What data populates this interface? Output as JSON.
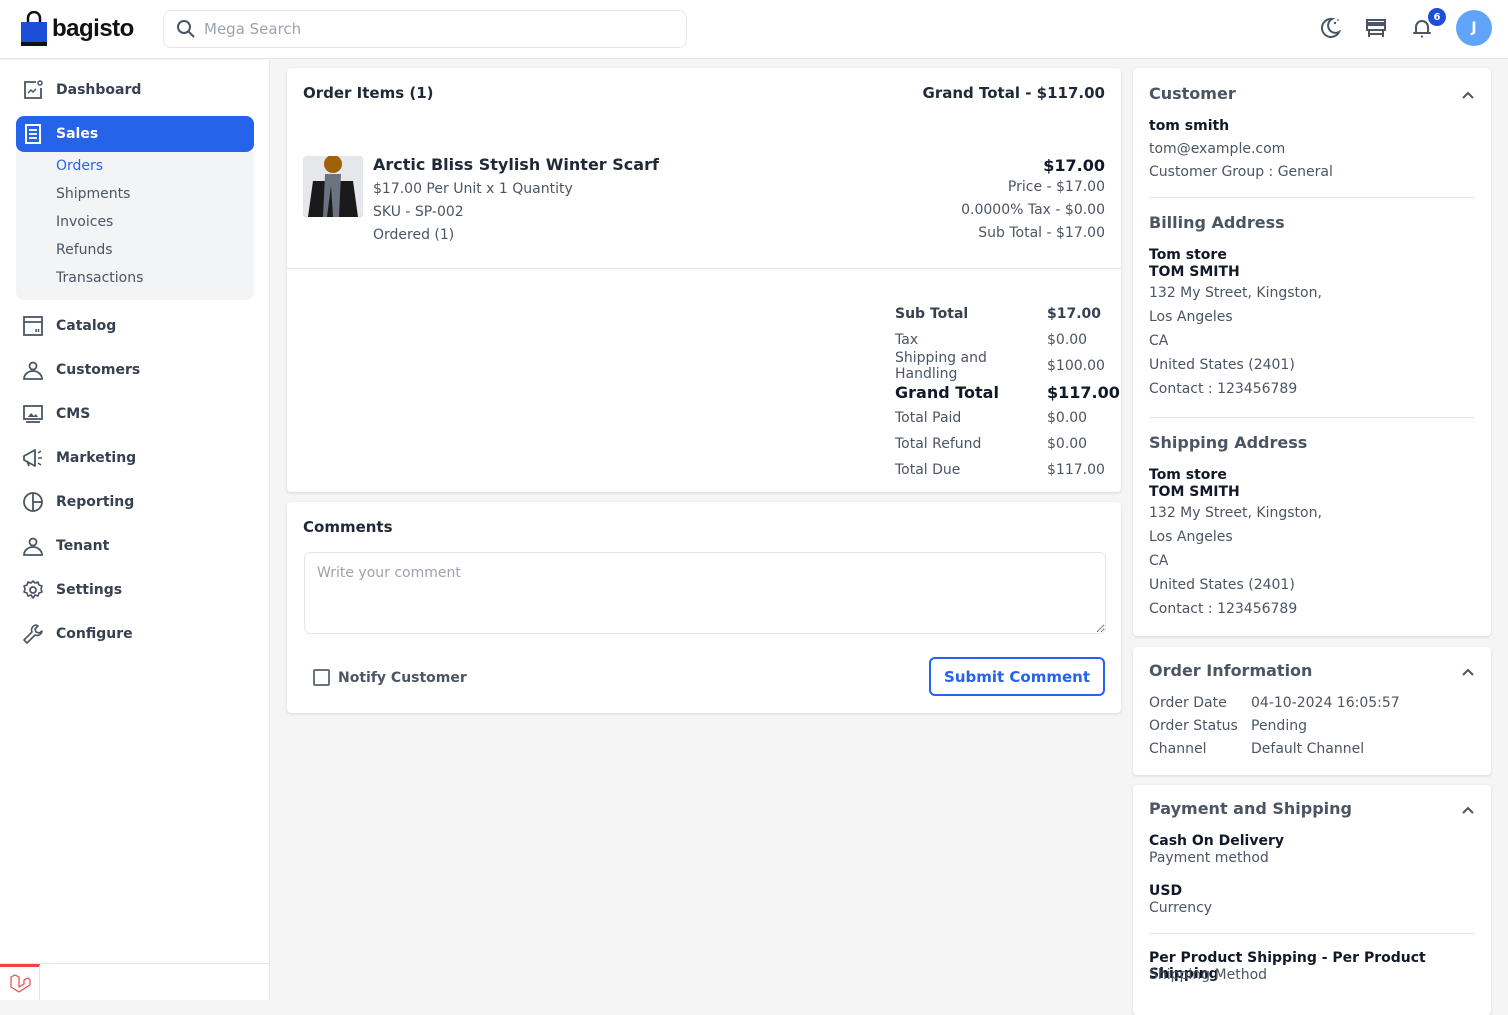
{
  "app": {
    "brand": "bagisto"
  },
  "header": {
    "search_placeholder": "Mega Search",
    "notification_count": "6",
    "avatar_initial": "J"
  },
  "sidebar": {
    "items": [
      {
        "label": "Dashboard",
        "icon": "dashboard-icon"
      },
      {
        "label": "Sales",
        "icon": "sales-icon",
        "active": true
      },
      {
        "label": "Catalog",
        "icon": "catalog-icon"
      },
      {
        "label": "Customers",
        "icon": "customers-icon"
      },
      {
        "label": "CMS",
        "icon": "cms-icon"
      },
      {
        "label": "Marketing",
        "icon": "marketing-icon"
      },
      {
        "label": "Reporting",
        "icon": "reporting-icon"
      },
      {
        "label": "Tenant",
        "icon": "tenant-icon"
      },
      {
        "label": "Settings",
        "icon": "settings-icon"
      },
      {
        "label": "Configure",
        "icon": "configure-icon"
      }
    ],
    "sales_sub": [
      "Orders",
      "Shipments",
      "Invoices",
      "Refunds",
      "Transactions"
    ],
    "active_sub": "Orders"
  },
  "order_items": {
    "title": "Order Items (1)",
    "grand_total_label": "Grand Total - $117.00",
    "item": {
      "name": "Arctic Bliss Stylish Winter Scarf",
      "per_unit": "$17.00 Per Unit x 1 Quantity",
      "sku": "SKU - SP-002",
      "ordered": "Ordered (1)",
      "total": "$17.00",
      "price": "Price - $17.00",
      "tax": "0.0000% Tax - $0.00",
      "sub_total": "Sub Total - $17.00"
    },
    "summary": [
      {
        "label": "Sub Total",
        "value": "$17.00",
        "style": "bold"
      },
      {
        "label": "Tax",
        "value": "$0.00"
      },
      {
        "label": "Shipping and Handling",
        "value": "$100.00"
      },
      {
        "label": "Grand Total",
        "value": "$117.00",
        "style": "big"
      },
      {
        "label": "Total Paid",
        "value": "$0.00"
      },
      {
        "label": "Total Refund",
        "value": "$0.00"
      },
      {
        "label": "Total Due",
        "value": "$117.00"
      }
    ]
  },
  "comments": {
    "title": "Comments",
    "placeholder": "Write your comment",
    "notify_label": "Notify Customer",
    "submit_label": "Submit Comment"
  },
  "customer": {
    "title": "Customer",
    "name": "tom smith",
    "email": "tom@example.com",
    "group": "Customer Group : General"
  },
  "billing": {
    "title": "Billing Address",
    "company": "Tom store",
    "name": "TOM SMITH",
    "street": "132 My Street, Kingston,",
    "city": "Los Angeles",
    "state": "CA",
    "country": "United States (2401)",
    "contact": "Contact : 123456789"
  },
  "shipping": {
    "title": "Shipping Address",
    "company": "Tom store",
    "name": "TOM SMITH",
    "street": "132 My Street, Kingston,",
    "city": "Los Angeles",
    "state": "CA",
    "country": "United States (2401)",
    "contact": "Contact : 123456789"
  },
  "order_info": {
    "title": "Order Information",
    "rows": [
      {
        "label": "Order Date",
        "value": "04-10-2024 16:05:57"
      },
      {
        "label": "Order Status",
        "value": "Pending"
      },
      {
        "label": "Channel",
        "value": "Default Channel"
      }
    ]
  },
  "payment": {
    "title": "Payment and Shipping",
    "method": "Cash On Delivery",
    "method_label": "Payment method",
    "currency": "USD",
    "currency_label": "Currency",
    "shipping_method": "Per Product Shipping - Per Product Shipping",
    "shipping_method_label": "Shipping Method"
  },
  "colors": {
    "accent": "#2563eb",
    "avatar": "#60a5fa",
    "badge": "#1d4ed8"
  }
}
